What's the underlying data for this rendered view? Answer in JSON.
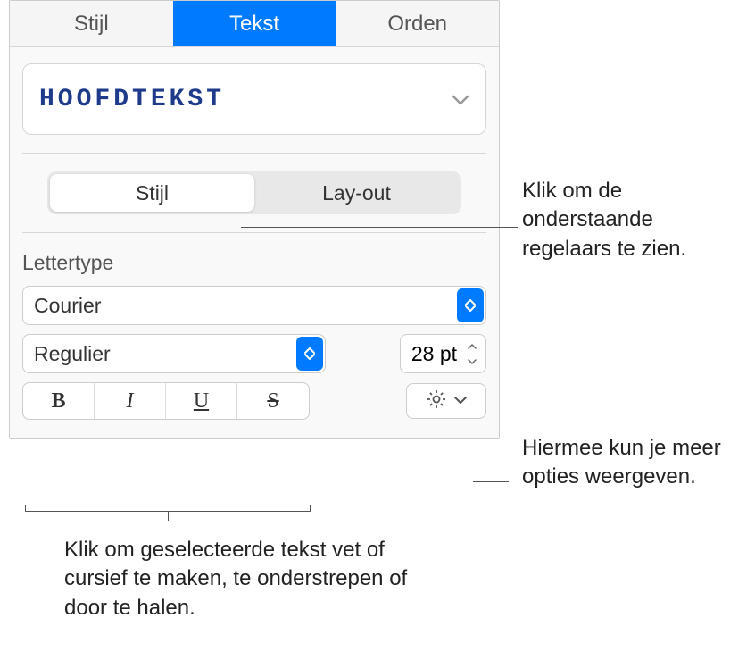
{
  "tabs": {
    "style": "Stijl",
    "text": "Tekst",
    "arrange": "Orden"
  },
  "paragraph_style": "HOOFDTEKST",
  "segmented": {
    "style": "Stijl",
    "layout": "Lay-out"
  },
  "font_section_label": "Lettertype",
  "font_family": "Courier",
  "font_weight": "Regulier",
  "font_size": "28 pt",
  "callouts": {
    "style_tab": "Klik om de onderstaande regelaars te zien.",
    "gear": "Hiermee kun je meer opties weergeven.",
    "format": "Klik om geselecteerde tekst vet of cursief te maken, te onderstrepen of door te halen."
  }
}
